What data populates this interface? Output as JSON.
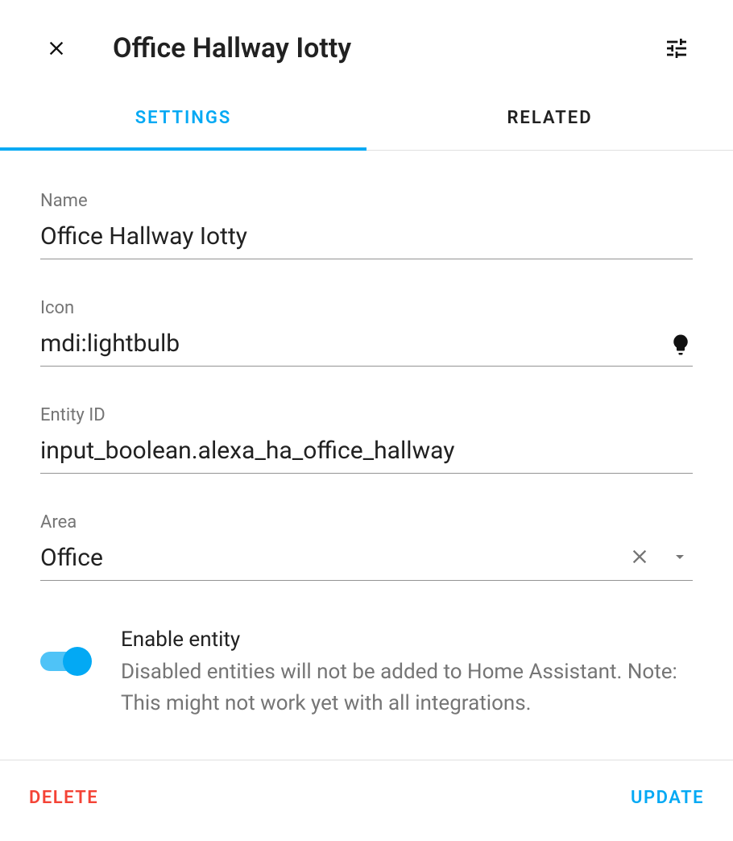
{
  "header": {
    "title": "Office Hallway Iotty"
  },
  "tabs": {
    "settings": "SETTINGS",
    "related": "RELATED"
  },
  "fields": {
    "name": {
      "label": "Name",
      "value": "Office Hallway Iotty"
    },
    "icon": {
      "label": "Icon",
      "value": "mdi:lightbulb"
    },
    "entity_id": {
      "label": "Entity ID",
      "value": "input_boolean.alexa_ha_office_hallway"
    },
    "area": {
      "label": "Area",
      "value": "Office"
    }
  },
  "toggle": {
    "title": "Enable entity",
    "description": "Disabled entities will not be added to Home Assistant. Note: This might not work yet with all integrations.",
    "enabled": true
  },
  "footer": {
    "delete": "DELETE",
    "update": "UPDATE"
  }
}
